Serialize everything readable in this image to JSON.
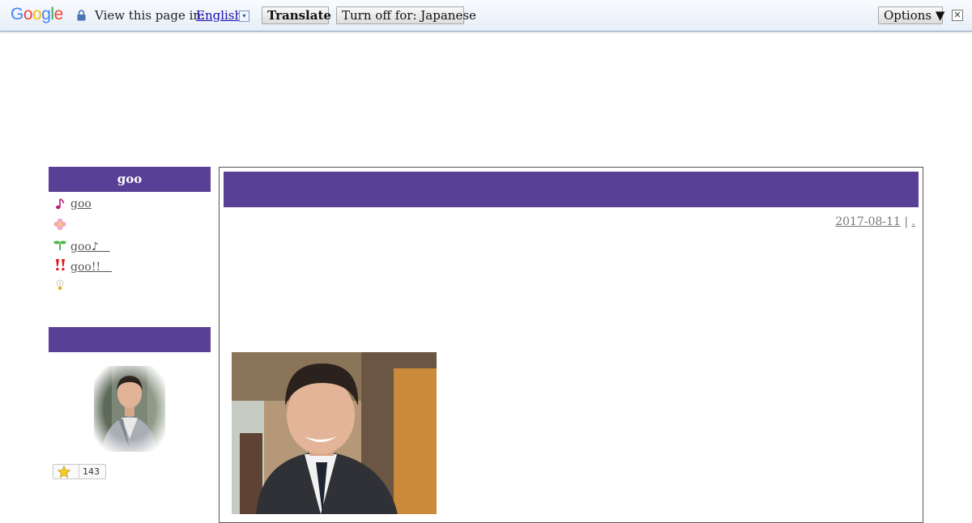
{
  "translate_bar": {
    "logo": [
      "G",
      "o",
      "o",
      "g",
      "l",
      "e"
    ],
    "view_label": "View this page in:",
    "language": "English",
    "dropdown_glyph": "▾",
    "translate_button": "Translate",
    "turn_off_button": "Turn off for: Japanese",
    "options_button": "Options ▼",
    "close_glyph": "✕"
  },
  "sidebar": {
    "header": "goo",
    "items": [
      {
        "icon": "music-note-icon",
        "label": "goo"
      },
      {
        "icon": "flower-icon",
        "label": ""
      },
      {
        "icon": "sprout-icon",
        "label": "goo♪　"
      },
      {
        "icon": "exclamation-icon",
        "label": "goo!!　"
      },
      {
        "icon": "lightbulb-icon",
        "label": ""
      }
    ],
    "section2_header": "",
    "star_count": "143"
  },
  "post": {
    "title": "",
    "date": "2017-08-11",
    "separator": " | ",
    "category": "."
  },
  "colors": {
    "accent": "#5a3f97"
  }
}
